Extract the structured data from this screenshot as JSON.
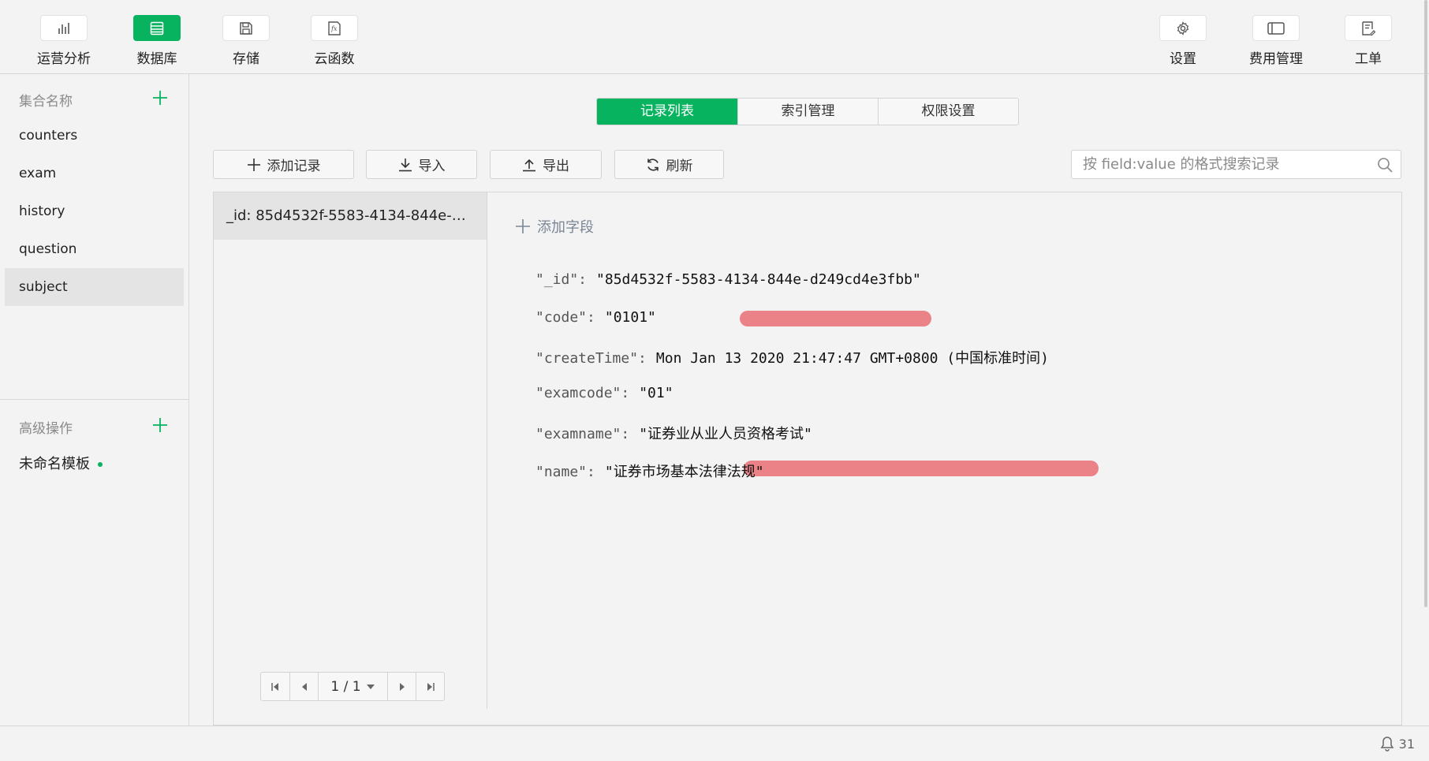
{
  "toolbar": {
    "left": [
      {
        "label": "运营分析",
        "icon": "bar-chart-icon"
      },
      {
        "label": "数据库",
        "icon": "database-icon",
        "active": true
      },
      {
        "label": "存储",
        "icon": "storage-icon"
      },
      {
        "label": "云函数",
        "icon": "function-icon"
      }
    ],
    "right": [
      {
        "label": "设置",
        "icon": "gear-icon"
      },
      {
        "label": "费用管理",
        "icon": "wallet-icon"
      },
      {
        "label": "工单",
        "icon": "ticket-icon"
      }
    ]
  },
  "sidebar": {
    "collections_title": "集合名称",
    "collections": [
      "counters",
      "exam",
      "history",
      "question",
      "subject"
    ],
    "selected_collection": "subject",
    "advanced_title": "高级操作",
    "template_name": "未命名模板"
  },
  "tabs": [
    "记录列表",
    "索引管理",
    "权限设置"
  ],
  "active_tab": "记录列表",
  "actions": {
    "add_record": "添加记录",
    "import": "导入",
    "export": "导出",
    "refresh": "刷新"
  },
  "search": {
    "placeholder": "按 field:value 的格式搜索记录"
  },
  "records": {
    "items": [
      "_id: 85d4532f-5583-4134-844e-d249cd4e3fbb"
    ],
    "pagination": "1 / 1"
  },
  "detail": {
    "add_field": "添加字段",
    "fields": [
      {
        "key": "\"_id\":",
        "value": "\"85d4532f-5583-4134-844e-d249cd4e3fbb\"",
        "highlighted": false
      },
      {
        "key": "\"code\":",
        "value": "\"0101\"",
        "highlighted": true
      },
      {
        "key": "\"createTime\":",
        "value": "Mon Jan 13 2020 21:47:47 GMT+0800 (中国标准时间)",
        "highlighted": false
      },
      {
        "key": "\"examcode\":",
        "value": "\"01\"",
        "highlighted": false
      },
      {
        "key": "\"examname\":",
        "value": "\"证券业从业人员资格考试\"",
        "highlighted": false
      },
      {
        "key": "\"name\":",
        "value": "\"证券市场基本法律法规\"",
        "highlighted": true
      }
    ],
    "highlight_color": "#ea8287"
  },
  "footer": {
    "notifications": "31"
  },
  "colors": {
    "accent": "#07b35e",
    "background": "#f3f3f3"
  }
}
